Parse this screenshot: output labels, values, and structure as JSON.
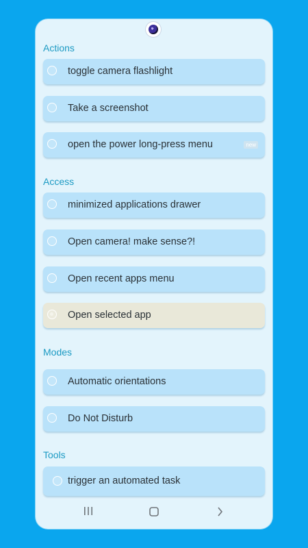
{
  "sections": [
    {
      "title": "Actions",
      "items": [
        {
          "label": "toggle camera flashlight"
        },
        {
          "label": "Take a screenshot"
        },
        {
          "label": "open the power long-press menu",
          "badge": "new"
        }
      ]
    },
    {
      "title": "Access",
      "items": [
        {
          "label": "minimized applications drawer"
        },
        {
          "label": "Open camera! make sense?!"
        },
        {
          "label": "Open recent apps menu"
        },
        {
          "label": "Open selected app",
          "selected": true
        }
      ]
    },
    {
      "title": "Modes",
      "items": [
        {
          "label": "Automatic orientations"
        },
        {
          "label": "Do Not Disturb"
        }
      ]
    },
    {
      "title": "Tools",
      "items": [
        {
          "label": "trigger an automated task"
        }
      ]
    }
  ],
  "navbar": {
    "recents_icon": "recents-icon",
    "home_icon": "home-icon",
    "back_icon": "back-icon"
  },
  "colors": {
    "background": "#0aa6ee",
    "card": "#e3f4fc",
    "item": "#b9e2fa",
    "selected_item": "#e9e8d9",
    "section_title": "#1c9ac3"
  }
}
